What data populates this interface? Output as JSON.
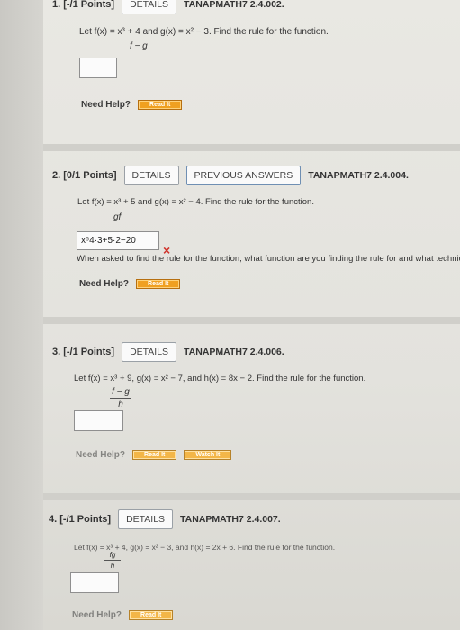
{
  "q1": {
    "head": {
      "num": "1. [-/1 Points]",
      "details": "DETAILS",
      "code": "TANAPMATH7 2.4.002."
    },
    "prompt": "Let f(x) = x³ + 4 and g(x) = x² − 3. Find the rule for the function.",
    "expr": "f − g",
    "help_label": "Need Help?",
    "read_label": "Read It"
  },
  "q2": {
    "head": {
      "num": "2. [0/1 Points]",
      "details": "DETAILS",
      "prev": "PREVIOUS ANSWERS",
      "code": "TANAPMATH7 2.4.004."
    },
    "prompt": "Let f(x) = x³ + 5 and g(x) = x² − 4. Find the rule for the function.",
    "expr": "gf",
    "answer": "x⁵4·3+5·2−20",
    "feedback_mark": "×",
    "feedback": "When asked to find the rule for the function, what function are you finding the rule for and what techniques w",
    "help_label": "Need Help?",
    "read_label": "Read It"
  },
  "q3": {
    "head": {
      "num": "3. [-/1 Points]",
      "details": "DETAILS",
      "code": "TANAPMATH7 2.4.006."
    },
    "prompt": "Let f(x) = x³ + 9, g(x) = x² − 7, and h(x) = 8x − 2. Find the rule for the function.",
    "expr_num": "f − g",
    "expr_den": "h",
    "help_label": "Need Help?",
    "read_label": "Read It",
    "watch_label": "Watch It"
  },
  "q4": {
    "head": {
      "num": "4. [-/1 Points]",
      "details": "DETAILS",
      "code": "TANAPMATH7 2.4.007."
    },
    "prompt": "Let f(x) = x³ + 4, g(x) = x² − 3, and h(x) = 2x + 6. Find the rule for the function.",
    "expr_num": "fg",
    "expr_den": "h",
    "help_label": "Need Help?",
    "read_label": "Read It"
  }
}
